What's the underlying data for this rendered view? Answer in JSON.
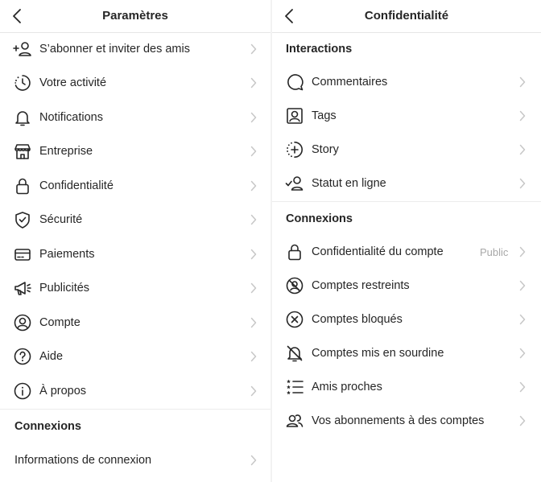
{
  "left": {
    "title": "Paramètres",
    "items": [
      {
        "label": "S’abonner et inviter des amis",
        "icon": "add-person-icon"
      },
      {
        "label": "Votre activité",
        "icon": "activity-clock-icon"
      },
      {
        "label": "Notifications",
        "icon": "bell-icon"
      },
      {
        "label": "Entreprise",
        "icon": "shop-icon"
      },
      {
        "label": "Confidentialité",
        "icon": "lock-icon"
      },
      {
        "label": "Sécurité",
        "icon": "shield-check-icon"
      },
      {
        "label": "Paiements",
        "icon": "credit-card-icon"
      },
      {
        "label": "Publicités",
        "icon": "megaphone-icon"
      },
      {
        "label": "Compte",
        "icon": "account-circle-icon"
      },
      {
        "label": "Aide",
        "icon": "help-icon"
      },
      {
        "label": "À propos",
        "icon": "info-icon"
      }
    ],
    "section_connexions": "Connexions",
    "login_info": "Informations de connexion"
  },
  "right": {
    "title": "Confidentialité",
    "section_interactions": "Interactions",
    "interactions": [
      {
        "label": "Commentaires",
        "icon": "comment-icon"
      },
      {
        "label": "Tags",
        "icon": "tag-person-icon"
      },
      {
        "label": "Story",
        "icon": "story-add-icon"
      },
      {
        "label": "Statut en ligne",
        "icon": "online-status-icon"
      }
    ],
    "section_connexions": "Connexions",
    "connexions": [
      {
        "label": "Confidentialité du compte",
        "icon": "lock-icon",
        "value": "Public"
      },
      {
        "label": "Comptes restreints",
        "icon": "restricted-icon"
      },
      {
        "label": "Comptes bloqués",
        "icon": "blocked-icon"
      },
      {
        "label": "Comptes mis en sourdine",
        "icon": "muted-bell-icon"
      },
      {
        "label": "Amis proches",
        "icon": "close-friends-list-icon"
      },
      {
        "label": "Vos abonnements à des comptes",
        "icon": "following-people-icon"
      }
    ]
  },
  "colors": {
    "text": "#262626",
    "chevron": "#c7c7c7",
    "secondary": "#a8a8a8",
    "separator": "#ececec"
  }
}
